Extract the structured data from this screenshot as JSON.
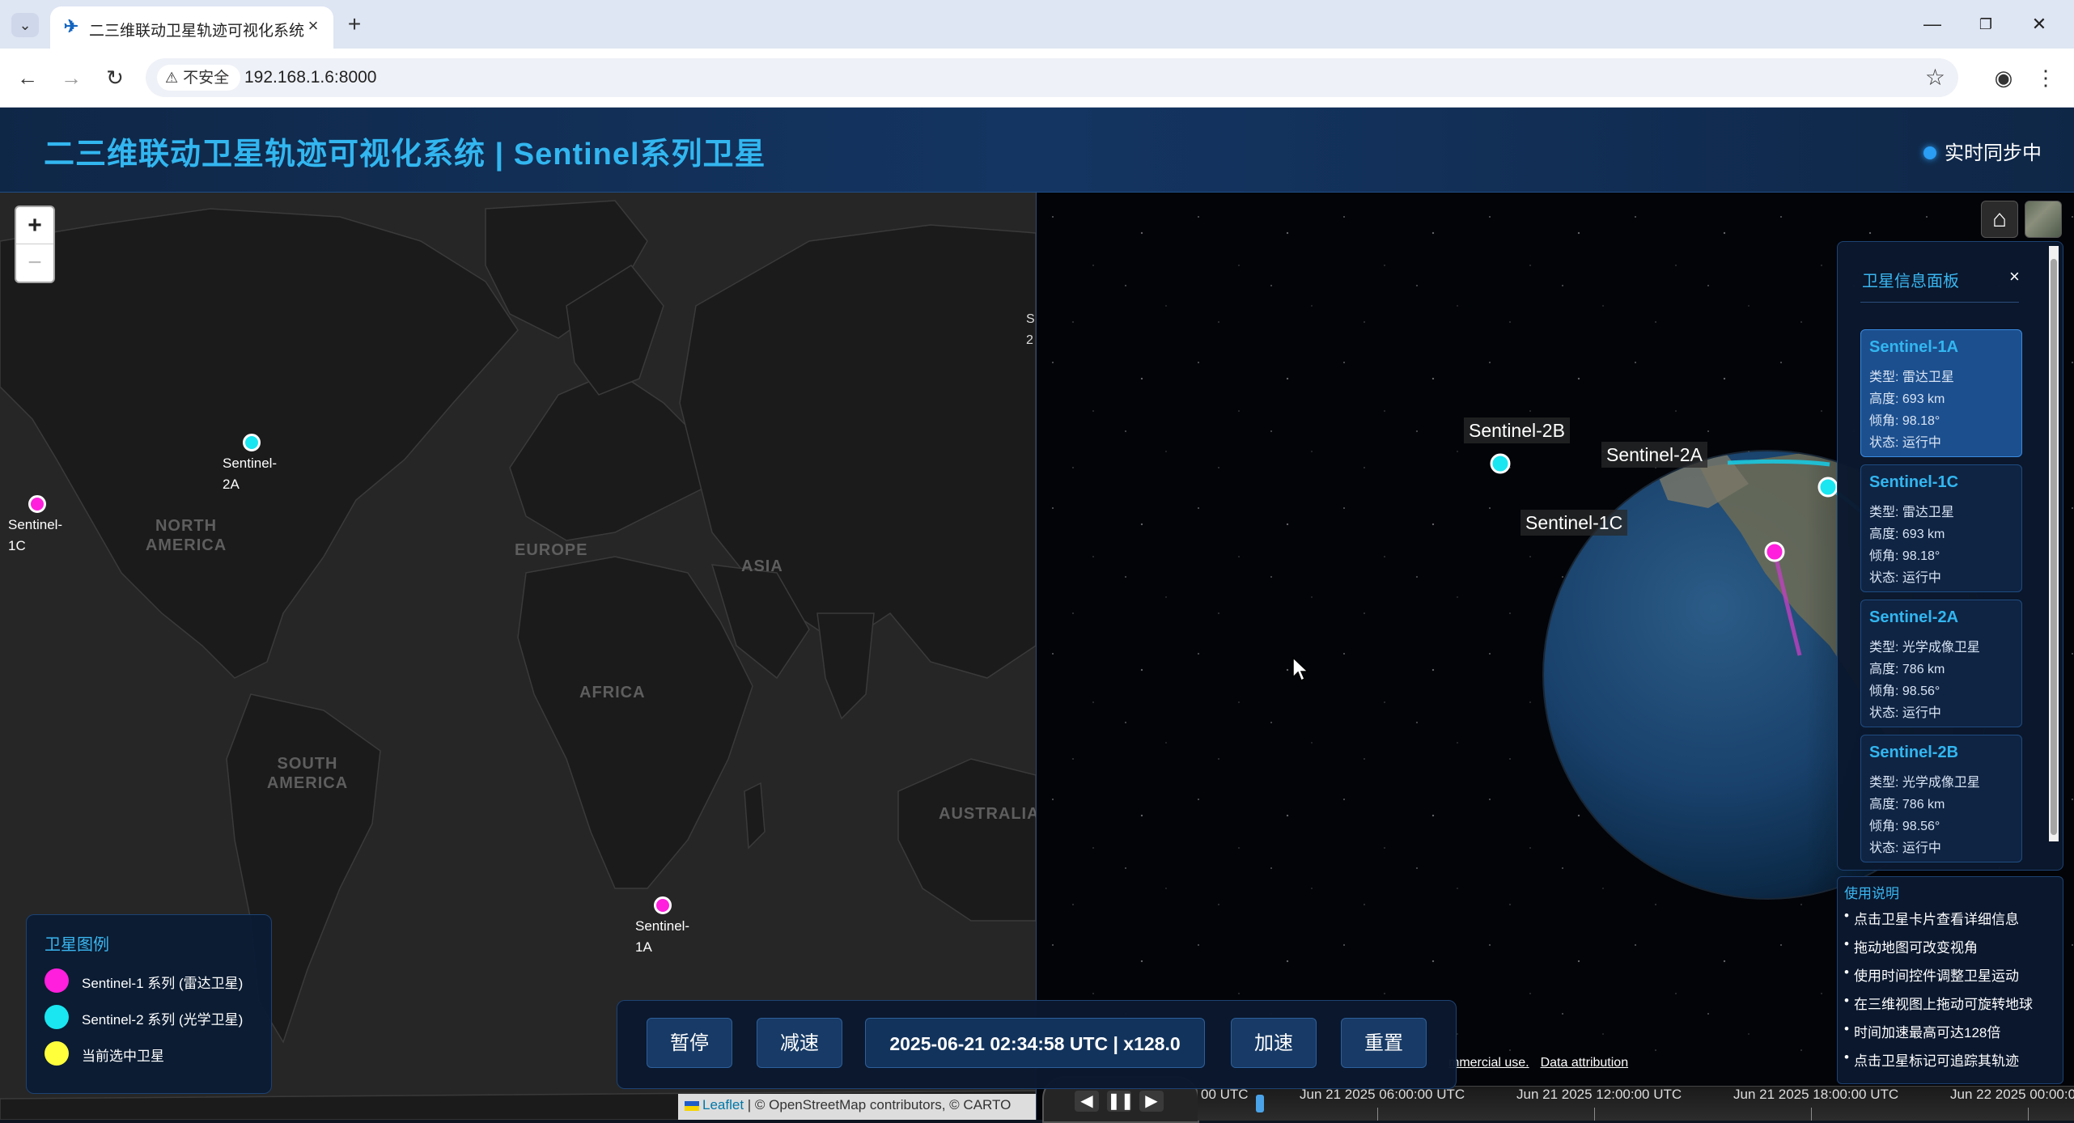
{
  "browser": {
    "tab_title": "二三维联动卫星轨迹可视化系统",
    "security_label": "不安全",
    "url": "192.168.1.6:8000"
  },
  "header": {
    "title": "二三维联动卫星轨迹可视化系统 | Sentinel系列卫星",
    "sync_status": "实时同步中"
  },
  "map2d": {
    "continents": {
      "north_america": "NORTH\nAMERICA",
      "europe": "EUROPE",
      "asia": "ASIA",
      "africa": "AFRICA",
      "south_america": "SOUTH\nAMERICA",
      "australia": "AUSTRALIA"
    },
    "markers": {
      "s2a_line1": "Sentinel-",
      "s2a_line2": "2A",
      "s1c_line1": "Sentinel-",
      "s1c_line2": "1C",
      "s1a_line1": "Sentinel-",
      "s1a_line2": "1A"
    },
    "edge_label_line1": "S",
    "edge_label_line2": "2",
    "attribution_leaflet": "Leaflet",
    "attribution_rest": "| © OpenStreetMap contributors, © CARTO"
  },
  "legend": {
    "title": "卫星图例",
    "items": [
      {
        "label": "Sentinel-1 系列 (雷达卫星)",
        "color": "#ff1fdc"
      },
      {
        "label": "Sentinel-2 系列 (光学卫星)",
        "color": "#19e6f0"
      },
      {
        "label": "当前选中卫星",
        "color": "#ffff3c"
      }
    ]
  },
  "globe": {
    "labels": {
      "s2b": "Sentinel-2B",
      "s2a": "Sentinel-2A",
      "s1c": "Sentinel-1C"
    },
    "credit_commercial": "mmercial use.",
    "credit_data": "Data attribution"
  },
  "info_panel": {
    "title": "卫星信息面板",
    "close": "×",
    "satellites": [
      {
        "name": "Sentinel-1A",
        "type": "类型: 雷达卫星",
        "altitude": "高度: 693 km",
        "inclination": "倾角: 98.18°",
        "status": "状态: 运行中"
      },
      {
        "name": "Sentinel-1C",
        "type": "类型: 雷达卫星",
        "altitude": "高度: 693 km",
        "inclination": "倾角: 98.18°",
        "status": "状态: 运行中"
      },
      {
        "name": "Sentinel-2A",
        "type": "类型: 光学成像卫星",
        "altitude": "高度: 786 km",
        "inclination": "倾角: 98.56°",
        "status": "状态: 运行中"
      },
      {
        "name": "Sentinel-2B",
        "type": "类型: 光学成像卫星",
        "altitude": "高度: 786 km",
        "inclination": "倾角: 98.56°",
        "status": "状态: 运行中"
      }
    ]
  },
  "help": {
    "title": "使用说明",
    "items": [
      "点击卫星卡片查看详细信息",
      "拖动地图可改变视角",
      "使用时间控件调整卫星运动",
      "在三维视图上拖动可旋转地球",
      "时间加速最高可达128倍",
      "点击卫星标记可追踪其轨迹"
    ]
  },
  "timeline": {
    "labels": [
      "00 UTC",
      "Jun 21 2025 06:00:00 UTC",
      "Jun 21 2025 12:00:00 UTC",
      "Jun 21 2025 18:00:00 UTC",
      "Jun 22 2025 00:00:00"
    ]
  },
  "time_control": {
    "pause": "暂停",
    "slower": "减速",
    "display": "2025-06-21 02:34:58 UTC | x128.0",
    "faster": "加速",
    "reset": "重置"
  }
}
